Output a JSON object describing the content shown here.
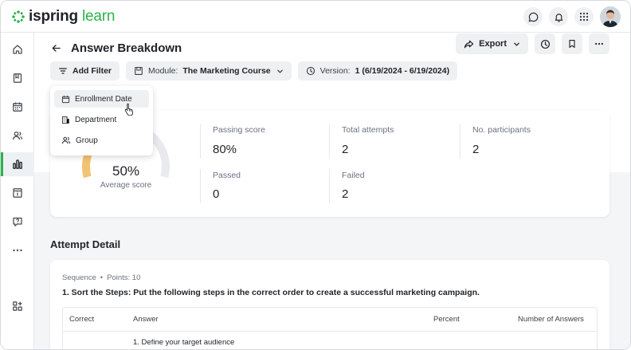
{
  "app": {
    "logo_main": "ispring",
    "logo_accent": "learn",
    "brand_color": "#2cb34a"
  },
  "topbar": {
    "icons": [
      "chat-icon",
      "bell-icon",
      "apps-grid-icon",
      "user-avatar"
    ]
  },
  "sidebar": {
    "items": [
      {
        "icon": "home-icon"
      },
      {
        "icon": "book-icon"
      },
      {
        "icon": "calendar-icon"
      },
      {
        "icon": "users-icon"
      },
      {
        "icon": "reports-icon",
        "active": true
      },
      {
        "icon": "info-board-icon"
      },
      {
        "icon": "help-icon"
      },
      {
        "icon": "more-icon"
      },
      {
        "icon": "add-widget-icon"
      }
    ]
  },
  "header": {
    "title": "Answer Breakdown",
    "export_label": "Export"
  },
  "filters": {
    "add_filter_label": "Add Filter",
    "module_key": "Module:",
    "module_value": "The Marketing Course",
    "version_key": "Version:",
    "version_value": "1 (6/19/2024 - 6/19/2024)"
  },
  "dropdown": {
    "items": [
      {
        "label": "Enrollment Date",
        "icon": "calendar-icon",
        "hovered": true
      },
      {
        "label": "Department",
        "icon": "building-icon"
      },
      {
        "label": "Group",
        "icon": "group-icon"
      }
    ]
  },
  "summary": {
    "average_score_value": "50%",
    "average_score_label": "Average score",
    "average_score_fraction": 0.5,
    "passing_score_label": "Passing score",
    "passing_score_value": "80%",
    "total_attempts_label": "Total attempts",
    "total_attempts_value": "2",
    "participants_label": "No. participants",
    "participants_value": "2",
    "passed_label": "Passed",
    "passed_value": "0",
    "failed_label": "Failed",
    "failed_value": "2"
  },
  "attempt_detail": {
    "section_title": "Attempt Detail",
    "question_type": "Sequence",
    "points": "Points: 10",
    "question": "1. Sort the Steps: Put the following steps in the correct order to create a successful marketing campaign.",
    "columns": [
      "Correct",
      "Answer",
      "Percent",
      "Number of Answers"
    ],
    "rows": [
      {
        "answer": "1.  Define your target audience"
      }
    ]
  }
}
